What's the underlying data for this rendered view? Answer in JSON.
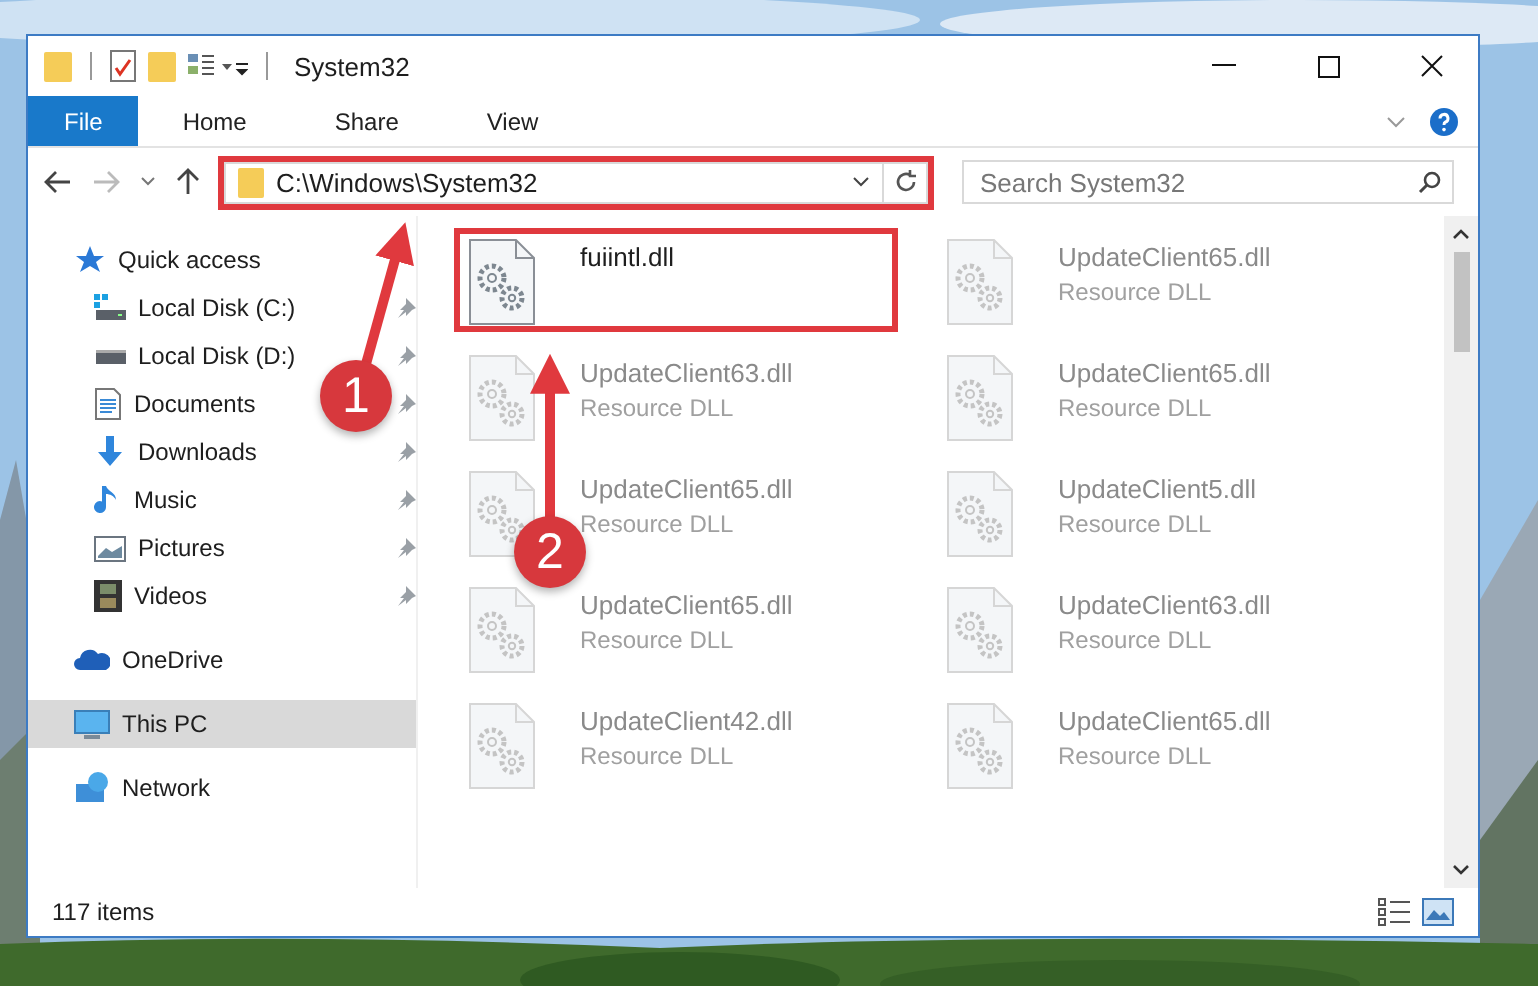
{
  "window": {
    "title": "System32"
  },
  "ribbon_tabs": [
    {
      "label": "File",
      "kind": "file"
    },
    {
      "label": "Home",
      "kind": "tab"
    },
    {
      "label": "Share",
      "kind": "tab"
    },
    {
      "label": "View",
      "kind": "tab"
    }
  ],
  "address_bar": {
    "path": "C:\\Windows\\System32",
    "highlighted": true
  },
  "search": {
    "placeholder": "Search System32"
  },
  "sidebar": {
    "items": [
      {
        "label": "Quick access",
        "kind": "star",
        "selected": false,
        "children": [
          {
            "label": "Local Disk (C:)",
            "kind": "system-drive",
            "pinned": true
          },
          {
            "label": "Local Disk (D:)",
            "kind": "drive",
            "pinned": true
          },
          {
            "label": "Documents",
            "kind": "documents",
            "pinned": true
          },
          {
            "label": "Downloads",
            "kind": "downloads",
            "pinned": true
          },
          {
            "label": "Music",
            "kind": "music",
            "pinned": true
          },
          {
            "label": "Pictures",
            "kind": "pictures",
            "pinned": true
          },
          {
            "label": "Videos",
            "kind": "videos",
            "pinned": true
          }
        ]
      },
      {
        "label": "OneDrive",
        "kind": "cloud",
        "selected": false
      },
      {
        "label": "This PC",
        "kind": "pc",
        "selected": true
      },
      {
        "label": "Network",
        "kind": "network",
        "selected": false
      }
    ]
  },
  "files": [
    {
      "name": "fuiintl.dll",
      "dimmed": false,
      "highlighted": true
    },
    {
      "name": "UpdateClient65.dll",
      "type": "Resource DLL",
      "dimmed": true,
      "highlighted": false
    },
    {
      "name": "UpdateClient63.dll",
      "type": "Resource DLL",
      "dimmed": true,
      "highlighted": false
    },
    {
      "name": "UpdateClient65.dll",
      "type": "Resource DLL",
      "dimmed": true,
      "highlighted": false
    },
    {
      "name": "UpdateClient65.dll",
      "type": "Resource DLL",
      "dimmed": true,
      "highlighted": false
    },
    {
      "name": "UpdateClient5.dll",
      "type": "Resource DLL",
      "dimmed": true,
      "highlighted": false
    },
    {
      "name": "UpdateClient65.dll",
      "type": "Resource DLL",
      "dimmed": true,
      "highlighted": false
    },
    {
      "name": "UpdateClient63.dll",
      "type": "Resource DLL",
      "dimmed": true,
      "highlighted": false
    },
    {
      "name": "UpdateClient42.dll",
      "type": "Resource DLL",
      "dimmed": true,
      "highlighted": false
    },
    {
      "name": "UpdateClient65.dll",
      "type": "Resource DLL",
      "dimmed": true,
      "highlighted": false
    }
  ],
  "status_bar": {
    "item_count": "117 items"
  },
  "annotations": [
    {
      "label": "1"
    },
    {
      "label": "2"
    }
  ]
}
